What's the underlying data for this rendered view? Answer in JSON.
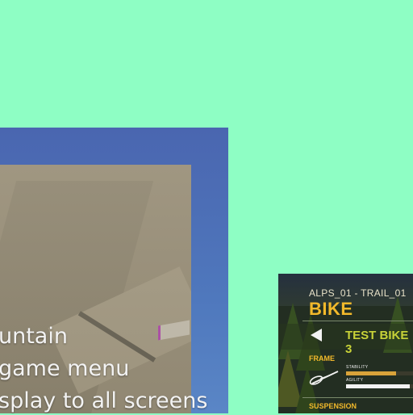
{
  "slide": {
    "caption_line1": "untain",
    "caption_line2": "game menu",
    "caption_line3": "splay to all screens"
  },
  "bike_menu": {
    "track": "ALPS_01 - TRAIL_01",
    "title": "BIKE",
    "bike_name": "TEST BIKE 3",
    "frame_label": "FRAME",
    "stability_label": "STABILITY",
    "agility_label": "AGILITY",
    "suspension_label": "SUSPENSION",
    "stability_value": 0.75,
    "agility_value": 0.95
  },
  "colors": {
    "background": "#8efec4",
    "panel_blue": "#4b6bb3",
    "accent_gold": "#f2b92b",
    "bike_name_green": "#c8d238"
  }
}
